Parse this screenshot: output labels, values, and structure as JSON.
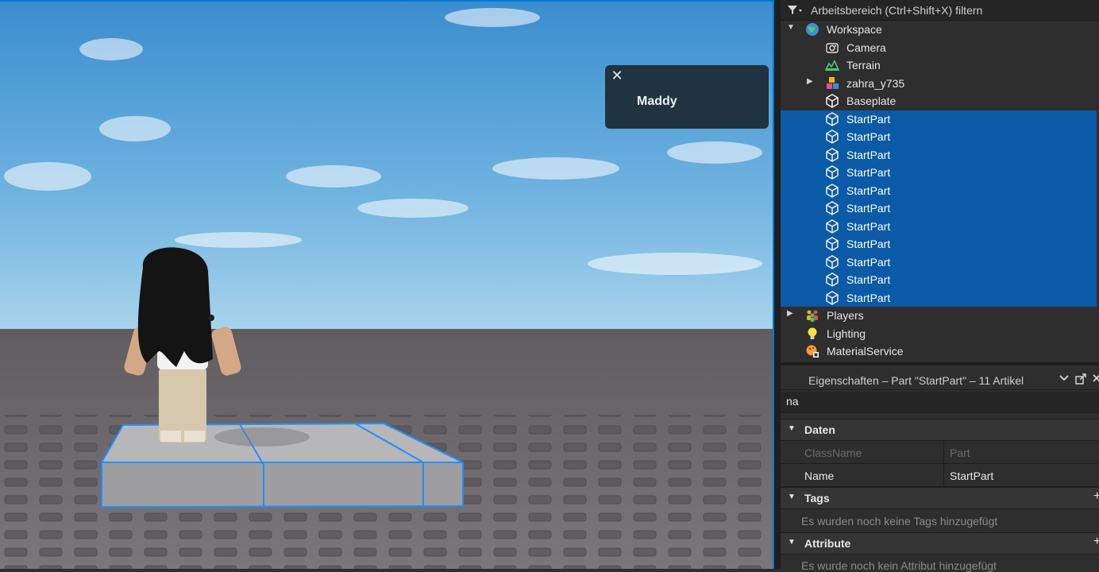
{
  "viewport": {
    "toast": {
      "close_glyph": "✕",
      "name": "Maddy"
    }
  },
  "explorer": {
    "filter_placeholder": "Arbeitsbereich (Ctrl+Shift+X) filtern",
    "items": [
      {
        "label": "Workspace",
        "icon": "workspace-icon",
        "arrow": "▼",
        "selected": false
      },
      {
        "label": "Camera",
        "icon": "camera-icon",
        "arrow": "",
        "selected": false
      },
      {
        "label": "Terrain",
        "icon": "terrain-icon",
        "arrow": "",
        "selected": false
      },
      {
        "label": "zahra_y735",
        "icon": "model-icon",
        "arrow": "▶",
        "selected": false
      },
      {
        "label": "Baseplate",
        "icon": "part-icon",
        "arrow": "",
        "selected": false
      },
      {
        "label": "StartPart",
        "icon": "part-icon",
        "arrow": "",
        "selected": true
      },
      {
        "label": "StartPart",
        "icon": "part-icon",
        "arrow": "",
        "selected": true
      },
      {
        "label": "StartPart",
        "icon": "part-icon",
        "arrow": "",
        "selected": true
      },
      {
        "label": "StartPart",
        "icon": "part-icon",
        "arrow": "",
        "selected": true
      },
      {
        "label": "StartPart",
        "icon": "part-icon",
        "arrow": "",
        "selected": true
      },
      {
        "label": "StartPart",
        "icon": "part-icon",
        "arrow": "",
        "selected": true
      },
      {
        "label": "StartPart",
        "icon": "part-icon",
        "arrow": "",
        "selected": true
      },
      {
        "label": "StartPart",
        "icon": "part-icon",
        "arrow": "",
        "selected": true
      },
      {
        "label": "StartPart",
        "icon": "part-icon",
        "arrow": "",
        "selected": true
      },
      {
        "label": "StartPart",
        "icon": "part-icon",
        "arrow": "",
        "selected": true
      },
      {
        "label": "StartPart",
        "icon": "part-icon",
        "arrow": "",
        "selected": true
      },
      {
        "label": "Players",
        "icon": "players-icon",
        "arrow": "▶",
        "selected": false
      },
      {
        "label": "Lighting",
        "icon": "lighting-icon",
        "arrow": "",
        "selected": false
      },
      {
        "label": "MaterialService",
        "icon": "material-service-icon",
        "arrow": "",
        "selected": false
      }
    ]
  },
  "properties": {
    "title": "Eigenschaften – Part \"StartPart\" – 11 Artikel",
    "search_value": "na",
    "categories": {
      "daten": "Daten",
      "tags": "Tags",
      "attribute": "Attribute"
    },
    "rows": {
      "classname_key": "ClassName",
      "classname_value": "Part",
      "name_key": "Name",
      "name_value": "StartPart"
    },
    "tags_empty": "Es wurden noch keine Tags hinzugefügt",
    "attribute_empty": "Es wurde noch kein Attribut hinzugefügt"
  },
  "colors": {
    "selection": "#0b5aa8",
    "viewport_border": "#0078d7",
    "sky_top": "#3d8fd0",
    "baseplate": "#6e6a6e",
    "selection_box": "#1e8fff"
  }
}
